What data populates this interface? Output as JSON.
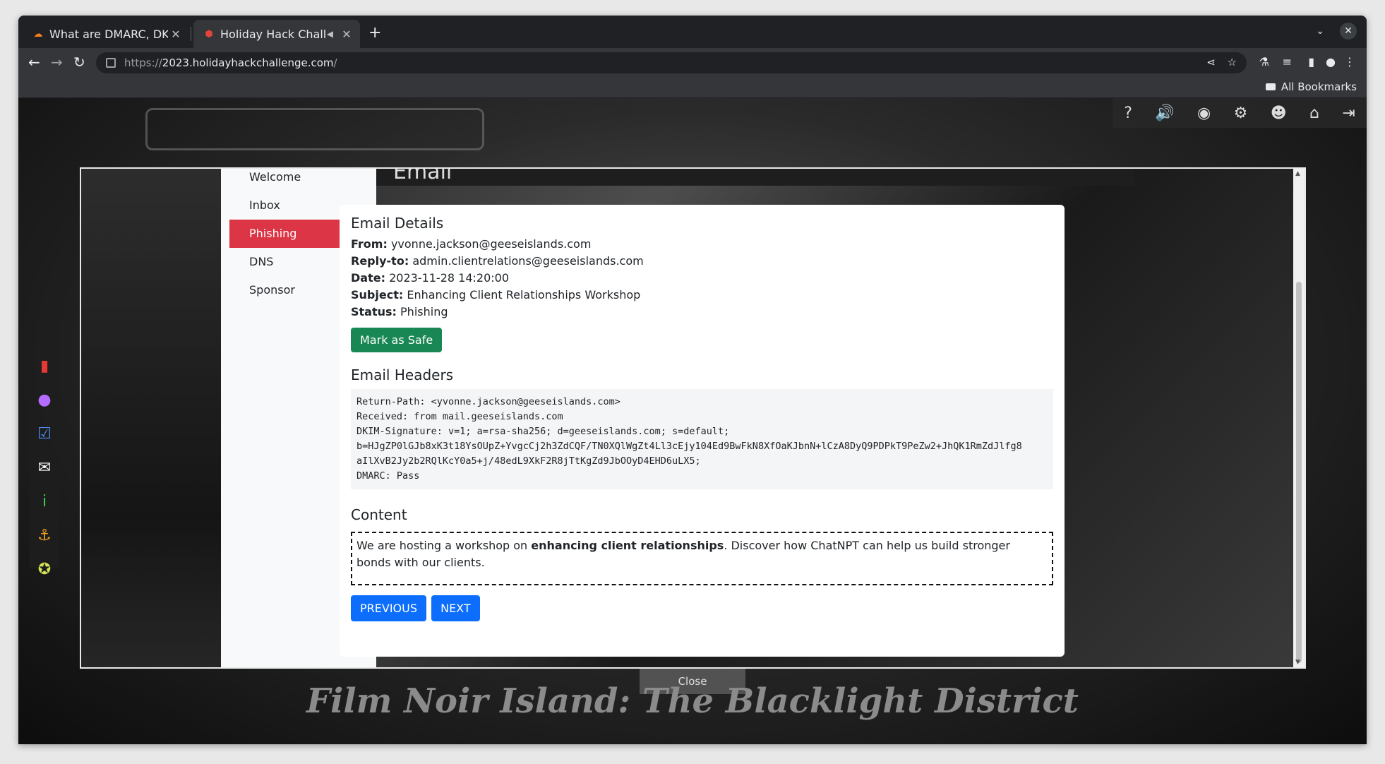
{
  "browser": {
    "tabs": [
      {
        "title": "What are DMARC, DKIM",
        "favicon": "cloudflare-icon",
        "active": false
      },
      {
        "title": "Holiday Hack Challe",
        "favicon": "shield-icon",
        "active": true
      }
    ],
    "url_prefix": "https://",
    "url_host": "2023.holidayhackchallenge.com",
    "url_path": "/",
    "bookmarks_label": "All Bookmarks"
  },
  "game": {
    "island_title": "Film Noir Island: The Blacklight District",
    "close_label": "Close",
    "top_icons": [
      "help-icon",
      "sound-icon",
      "discord-icon",
      "settings-icon",
      "profile-icon",
      "home-icon",
      "logout-icon"
    ],
    "left_icons": [
      "book-icon",
      "map-pin-icon",
      "checklist-icon",
      "chat-icon",
      "info-icon",
      "anchor-icon",
      "badge-icon"
    ]
  },
  "modal": {
    "header_title": "Email",
    "nav": [
      {
        "label": "Welcome",
        "active": false
      },
      {
        "label": "Inbox",
        "active": false
      },
      {
        "label": "Phishing",
        "active": true
      },
      {
        "label": "DNS",
        "active": false
      },
      {
        "label": "Sponsor",
        "active": false
      }
    ],
    "email": {
      "details_heading": "Email Details",
      "from_label": "From:",
      "from": "yvonne.jackson@geeseislands.com",
      "reply_to_label": "Reply-to:",
      "reply_to": "admin.clientrelations@geeseislands.com",
      "date_label": "Date:",
      "date": "2023-11-28 14:20:00",
      "subject_label": "Subject:",
      "subject": "Enhancing Client Relationships Workshop",
      "status_label": "Status:",
      "status": "Phishing",
      "mark_safe_label": "Mark as Safe",
      "headers_heading": "Email Headers",
      "headers": [
        "Return-Path: <yvonne.jackson@geeseislands.com>",
        "Received: from mail.geeseislands.com",
        "DKIM-Signature: v=1; a=rsa-sha256; d=geeseislands.com; s=default;",
        "b=HJgZP0lGJb8xK3t18YsOUpZ+YvgcCj2h3ZdCQF/TN0XQlWgZt4Ll3cEjy104Ed9BwFkN8XfOaKJbnN+lCzA8DyQ9PDPkT9PeZw2+JhQK1RmZdJlfg8",
        "aIlXvB2Jy2b2RQlKcY0a5+j/48edL9XkF2R8jTtKgZd9JbOOyD4EHD6uLX5;",
        "DMARC: Pass"
      ],
      "content_heading": "Content",
      "content_pre": "We are hosting a workshop on ",
      "content_bold": "enhancing client relationships",
      "content_post": ". Discover how ChatNPT can help us build stronger bonds with our clients.",
      "previous_label": "PREVIOUS",
      "next_label": "NEXT"
    }
  },
  "colors": {
    "phishing_active": "#dc3545",
    "safe_button": "#198754",
    "pager_button": "#0d6efd"
  }
}
